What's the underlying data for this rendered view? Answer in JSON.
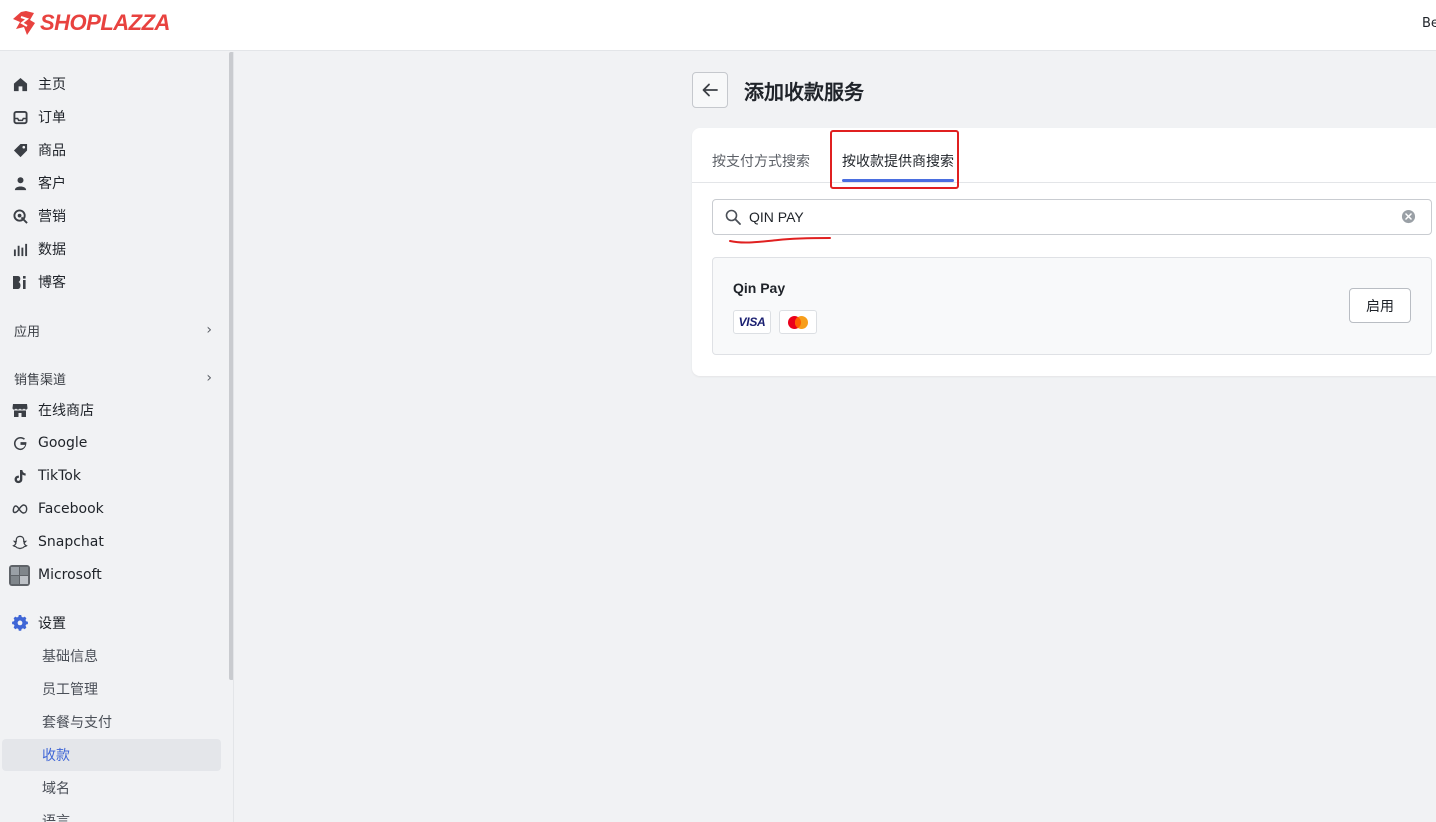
{
  "app": {
    "brand": "SHOPLAZZA",
    "topbar_right_text": "Be"
  },
  "sidebar": {
    "main_items": [
      {
        "label": "主页",
        "icon": "home-icon"
      },
      {
        "label": "订单",
        "icon": "inbox-icon"
      },
      {
        "label": "商品",
        "icon": "tag-icon"
      },
      {
        "label": "客户",
        "icon": "person-icon"
      },
      {
        "label": "营销",
        "icon": "target-icon"
      },
      {
        "label": "数据",
        "icon": "bar-chart-icon"
      },
      {
        "label": "博客",
        "icon": "blog-icon"
      }
    ],
    "apps_section": "应用",
    "channels_section": "销售渠道",
    "channels": [
      {
        "label": "在线商店",
        "icon": "store-icon"
      },
      {
        "label": "Google",
        "icon": "google-icon"
      },
      {
        "label": "TikTok",
        "icon": "tiktok-icon"
      },
      {
        "label": "Facebook",
        "icon": "meta-icon"
      },
      {
        "label": "Snapchat",
        "icon": "snapchat-icon"
      },
      {
        "label": "Microsoft",
        "icon": "microsoft-icon"
      }
    ],
    "settings": {
      "label": "设置",
      "icon": "gear-icon",
      "sub_items": [
        "基础信息",
        "员工管理",
        "套餐与支付",
        "收款",
        "域名",
        "语言"
      ],
      "active_sub_item": "收款"
    }
  },
  "page": {
    "title": "添加收款服务",
    "tabs": [
      "按支付方式搜索",
      "按收款提供商搜索"
    ],
    "active_tab": "按收款提供商搜索",
    "search": {
      "value": "QIN PAY",
      "placeholder": ""
    },
    "results": [
      {
        "name": "Qin Pay",
        "payment_methods": [
          "VISA",
          "mastercard"
        ],
        "action_label": "启用"
      }
    ]
  },
  "colors": {
    "brand": "#e8423f",
    "accent": "#4a6ee0",
    "annotation": "#e02020"
  }
}
